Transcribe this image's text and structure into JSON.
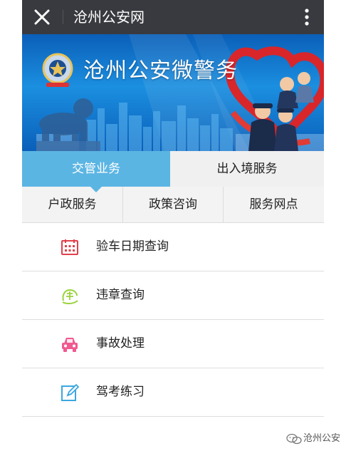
{
  "window": {
    "title": "沧州公安网"
  },
  "banner": {
    "title": "沧州公安微警务"
  },
  "tabs": [
    {
      "label": "交管业务",
      "active": true
    },
    {
      "label": "出入境服务",
      "active": false
    }
  ],
  "subtabs": [
    {
      "label": "户政服务"
    },
    {
      "label": "政策咨询"
    },
    {
      "label": "服务网点"
    }
  ],
  "list": [
    {
      "label": "验车日期查询",
      "icon": "calendar-icon"
    },
    {
      "label": "违章查询",
      "icon": "violation-icon"
    },
    {
      "label": "事故处理",
      "icon": "car-icon"
    },
    {
      "label": "驾考练习",
      "icon": "edit-icon"
    }
  ],
  "watermark": {
    "text": "沧州公安"
  },
  "colors": {
    "titlebar": "#393a3f",
    "tab_active": "#5bb5e3",
    "calendar": "#e0414b",
    "violation": "#9bd33a",
    "car": "#f0598f",
    "edit": "#3aa7e0"
  }
}
